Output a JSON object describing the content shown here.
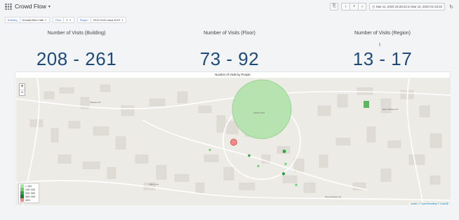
{
  "header": {
    "dashboard_title": "Crowd Flow",
    "time_range": "Mar 11, 2020 19:28:22 to Mar 12, 2020 01:34:22",
    "buttons": [
      "share-icon",
      "back-icon",
      "zoom-out-icon",
      "forward-icon",
      "clock-icon",
      "refresh-icon"
    ]
  },
  "variables": [
    {
      "label": "Building",
      "value": "Donald Bren Hall"
    },
    {
      "label": "Floor",
      "value": "2"
    },
    {
      "label": "Region",
      "value": "2019 3142-clwa 2019"
    }
  ],
  "stats": {
    "building": {
      "title": "Number of Visits (Building)",
      "value": "208 - 261"
    },
    "floor": {
      "title": "Number of Visits (Floor)",
      "value": "73 - 92"
    },
    "region": {
      "title": "Number of Visits (Region)",
      "value": "13 - 17"
    }
  },
  "map_panel": {
    "title": "Number of Visits by People",
    "zoom_in": "+",
    "zoom_out": "−",
    "attribution": "Leaflet | © OpenStreetMap © CartoDB",
    "legend": [
      {
        "label": "< 100",
        "color": "#a6e3a0"
      },
      {
        "label": "100~200",
        "color": "#6ccf6c"
      },
      {
        "label": "200~300",
        "color": "#2fa24a"
      },
      {
        "label": "300~400",
        "color": "#1c7a34"
      },
      {
        "label": "400+",
        "color": "#f28a8a"
      }
    ],
    "street_labels": [
      "Peltason Dr",
      "Aldrich Park",
      "East Peltason Dr",
      "Bison Ave",
      "West Peltason Dr",
      "Ring Mall",
      "Campus Dr"
    ]
  }
}
